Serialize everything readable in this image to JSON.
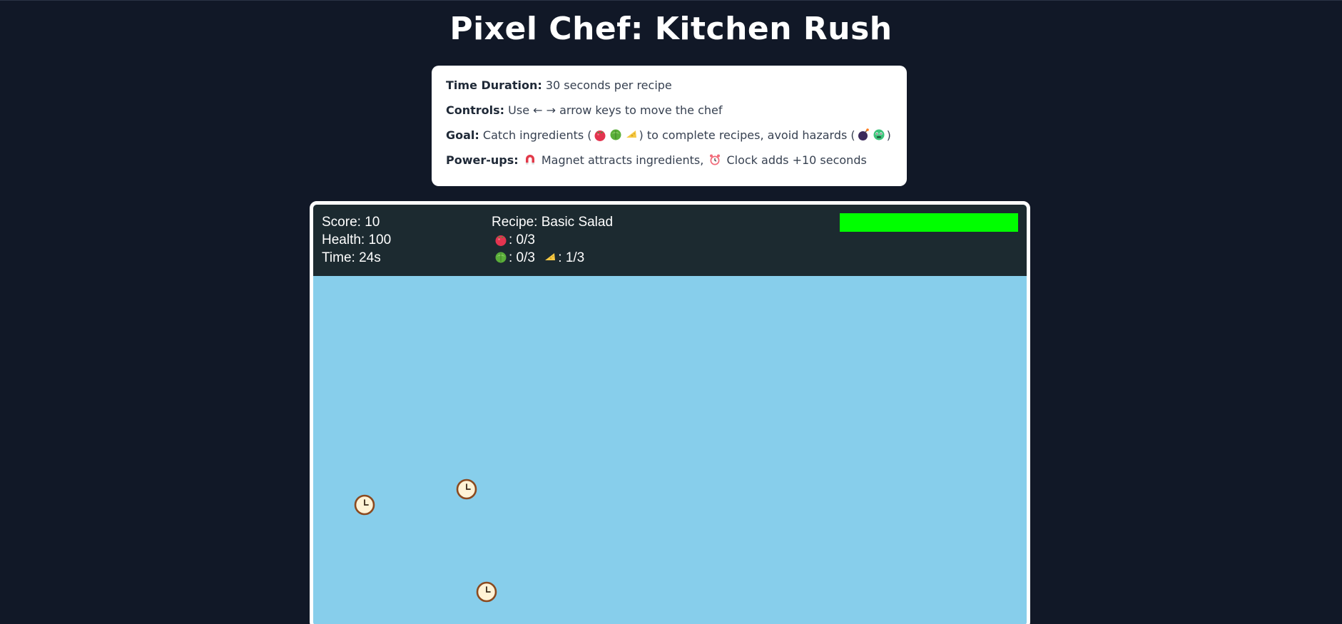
{
  "title": "Pixel Chef: Kitchen Rush",
  "info": {
    "time_label": "Time Duration:",
    "time_text": "30 seconds per recipe",
    "controls_label": "Controls:",
    "controls_text": "Use ← → arrow keys to move the chef",
    "goal_label": "Goal:",
    "goal_text_a": "Catch ingredients (",
    "goal_text_b": ") to complete recipes, avoid hazards (",
    "goal_text_c": ")",
    "powerups_label": "Power-ups:",
    "powerups_text_a": "Magnet attracts ingredients,",
    "powerups_text_b": "Clock adds +10 seconds"
  },
  "icons": {
    "tomato": "tomato-icon",
    "lettuce": "lettuce-icon",
    "cheese": "cheese-icon",
    "bomb": "bomb-icon",
    "germ": "germ-icon",
    "magnet": "magnet-icon",
    "alarm": "alarm-clock-icon",
    "clock_powerup": "clock-icon"
  },
  "hud": {
    "score": "Score: 10",
    "health": "Health: 100",
    "time": "Time: 24s",
    "recipe": "Recipe: Basic Salad",
    "tomato_progress": ": 0/3",
    "lettuce_progress": ": 0/3",
    "cheese_progress": ": 1/3",
    "health_fraction": 1.0,
    "health_color": "#00ff00"
  },
  "colors": {
    "background": "#111827",
    "hud_background": "#1c2a30",
    "field_background": "#87ceeb"
  },
  "falling_items": [
    {
      "type": "clock"
    },
    {
      "type": "clock"
    },
    {
      "type": "clock"
    }
  ]
}
